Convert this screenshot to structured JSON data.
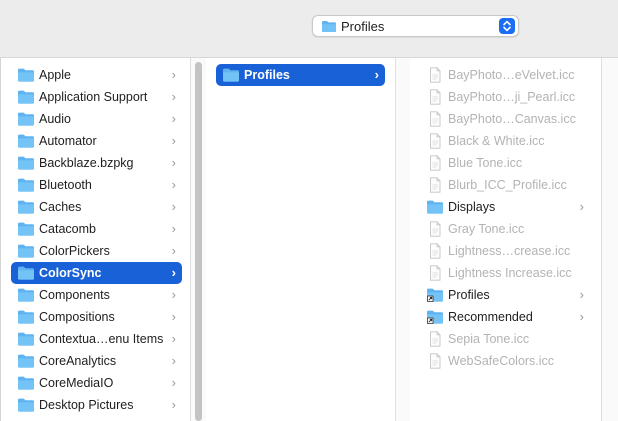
{
  "path_popup": {
    "label": "Profiles"
  },
  "columns": [
    {
      "items": [
        {
          "label": "Apple",
          "type": "folder",
          "chevron": "›"
        },
        {
          "label": "Application Support",
          "type": "folder",
          "chevron": "›"
        },
        {
          "label": "Audio",
          "type": "folder",
          "chevron": "›"
        },
        {
          "label": "Automator",
          "type": "folder",
          "chevron": "›"
        },
        {
          "label": "Backblaze.bzpkg",
          "type": "folder",
          "chevron": "›"
        },
        {
          "label": "Bluetooth",
          "type": "folder",
          "chevron": "›"
        },
        {
          "label": "Caches",
          "type": "folder",
          "chevron": "›"
        },
        {
          "label": "Catacomb",
          "type": "folder",
          "chevron": "›"
        },
        {
          "label": "ColorPickers",
          "type": "folder",
          "chevron": "›"
        },
        {
          "label": "ColorSync",
          "type": "folder",
          "chevron": "›",
          "selected": true
        },
        {
          "label": "Components",
          "type": "folder",
          "chevron": "›"
        },
        {
          "label": "Compositions",
          "type": "folder",
          "chevron": "›"
        },
        {
          "label": "Contextua…enu Items",
          "type": "folder",
          "chevron": "›"
        },
        {
          "label": "CoreAnalytics",
          "type": "folder",
          "chevron": "›"
        },
        {
          "label": "CoreMediaIO",
          "type": "folder",
          "chevron": "›"
        },
        {
          "label": "Desktop Pictures",
          "type": "folder",
          "chevron": "›"
        }
      ]
    },
    {
      "items": [
        {
          "label": "Profiles",
          "type": "folder",
          "chevron": "›",
          "selected": true
        }
      ]
    },
    {
      "items": [
        {
          "label": "BayPhoto…eVelvet.icc",
          "type": "file",
          "disabled": true
        },
        {
          "label": "BayPhoto…ji_Pearl.icc",
          "type": "file",
          "disabled": true
        },
        {
          "label": "BayPhoto…Canvas.icc",
          "type": "file",
          "disabled": true
        },
        {
          "label": "Black & White.icc",
          "type": "file",
          "disabled": true
        },
        {
          "label": "Blue Tone.icc",
          "type": "file",
          "disabled": true
        },
        {
          "label": "Blurb_ICC_Profile.icc",
          "type": "file",
          "disabled": true
        },
        {
          "label": "Displays",
          "type": "folder",
          "chevron": "›"
        },
        {
          "label": "Gray Tone.icc",
          "type": "file",
          "disabled": true
        },
        {
          "label": "Lightness…crease.icc",
          "type": "file",
          "disabled": true
        },
        {
          "label": "Lightness Increase.icc",
          "type": "file",
          "disabled": true
        },
        {
          "label": "Profiles",
          "type": "alias-folder",
          "chevron": "›"
        },
        {
          "label": "Recommended",
          "type": "alias-folder",
          "chevron": "›"
        },
        {
          "label": "Sepia Tone.icc",
          "type": "file",
          "disabled": true
        },
        {
          "label": "WebSafeColors.icc",
          "type": "file",
          "disabled": true
        }
      ]
    }
  ],
  "colors": {
    "selection": "#1961d6",
    "folder": "#5fb3f0",
    "disabled_text": "#b3b3b3"
  }
}
